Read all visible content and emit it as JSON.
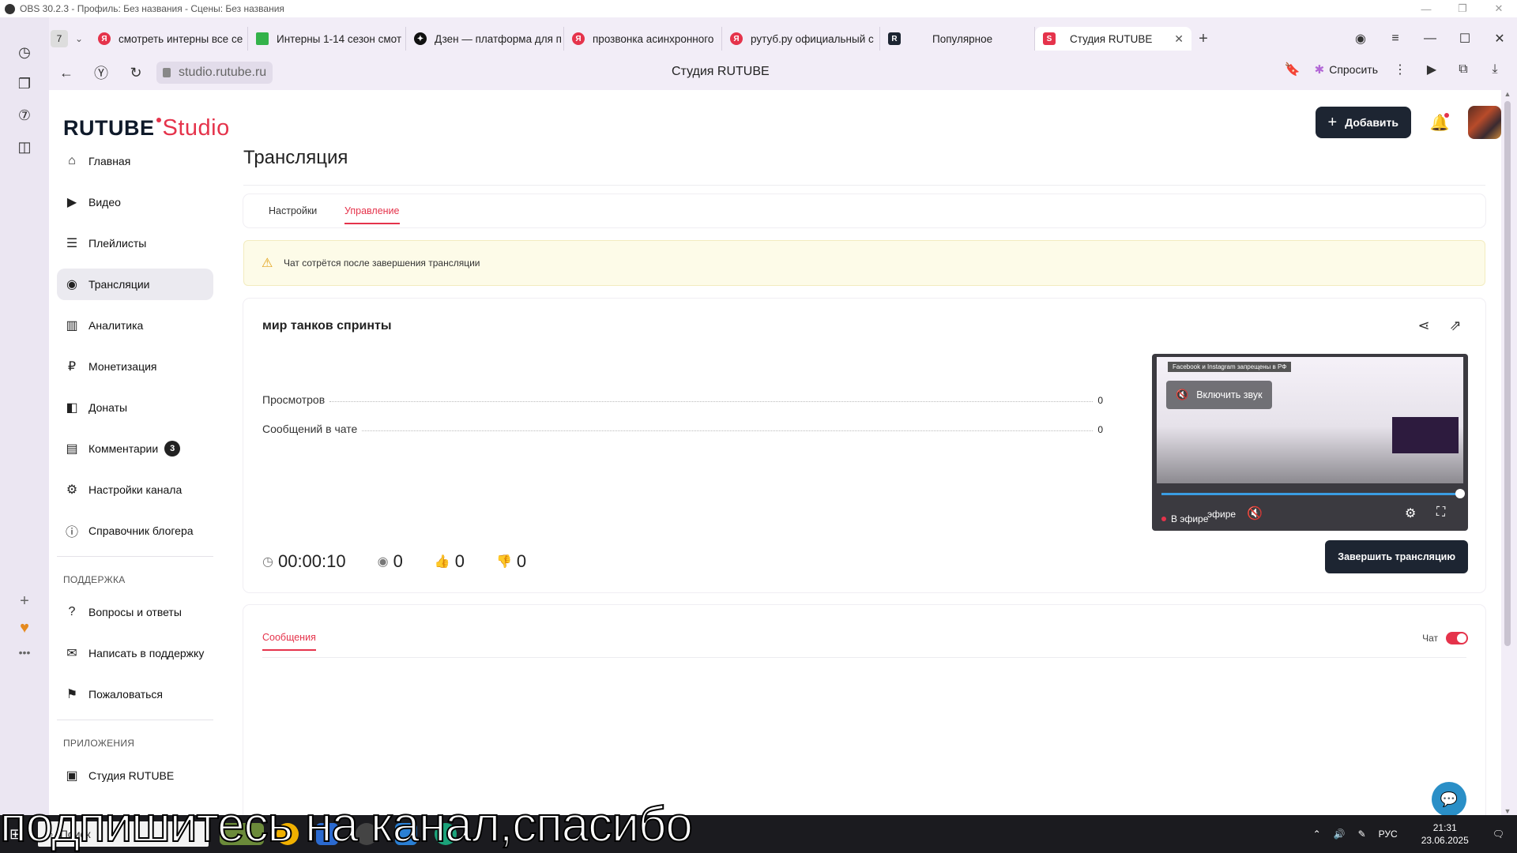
{
  "obs": {
    "title": "OBS 30.2.3 - Профиль: Без названия - Сцены: Без названия"
  },
  "browser": {
    "tab_counter": "7",
    "tabs": [
      {
        "label": "смотреть интерны все се",
        "icon": "yandex-icon",
        "color": "#e5334b"
      },
      {
        "label": "Интерны 1-14 сезон смот",
        "icon": "green-media-icon",
        "color": "#34b24a"
      },
      {
        "label": "Дзен — платформа для п",
        "icon": "dzen-icon",
        "color": "#111111"
      },
      {
        "label": "прозвонка асинхронного",
        "icon": "yandex-icon",
        "color": "#e5334b"
      },
      {
        "label": "рутуб.ру официальный с",
        "icon": "yandex-icon",
        "color": "#e5334b"
      },
      {
        "label": "Популярное",
        "icon": "rutube-icon",
        "color": "#1d2532"
      },
      {
        "label": "Студия RUTUBE",
        "icon": "rutube-studio-icon",
        "color": "#e5334b",
        "active": true
      }
    ],
    "url": "studio.rutube.ru",
    "page_title": "Студия RUTUBE",
    "ask_label": "Спросить"
  },
  "app": {
    "logo_main": "RUTUBE",
    "logo_studio": "Studio",
    "add_button": "Добавить",
    "nav": [
      {
        "label": "Главная",
        "icon": "home-icon"
      },
      {
        "label": "Видео",
        "icon": "video-icon"
      },
      {
        "label": "Плейлисты",
        "icon": "playlist-icon"
      },
      {
        "label": "Трансляции",
        "icon": "broadcast-icon",
        "active": true
      },
      {
        "label": "Аналитика",
        "icon": "analytics-icon"
      },
      {
        "label": "Монетизация",
        "icon": "ruble-icon"
      },
      {
        "label": "Донаты",
        "icon": "donate-icon"
      },
      {
        "label": "Комментарии",
        "icon": "comment-icon",
        "badge": "3"
      },
      {
        "label": "Настройки канала",
        "icon": "gear-icon"
      },
      {
        "label": "Справочник блогера",
        "icon": "info-icon"
      }
    ],
    "support_heading": "ПОДДЕРЖКА",
    "support": [
      {
        "label": "Вопросы и ответы",
        "icon": "question-icon"
      },
      {
        "label": "Написать в поддержку",
        "icon": "mail-icon"
      },
      {
        "label": "Пожаловаться",
        "icon": "flag-icon"
      }
    ],
    "apps_heading": "ПРИЛОЖЕНИЯ",
    "apps": [
      {
        "label": "Студия RUTUBE",
        "icon": "studio-app-icon"
      }
    ]
  },
  "main": {
    "title": "Трансляция",
    "tabs": [
      "Настройки",
      "Управление"
    ],
    "active_tab": "Управление",
    "alert": "Чат сотрётся после завершения трансляции",
    "stream_title": "мир танков спринты",
    "stats": [
      {
        "label": "Просмотров",
        "value": "0"
      },
      {
        "label": "Сообщений в чате",
        "value": "0"
      }
    ],
    "timer": "00:00:10",
    "viewers": "0",
    "likes": "0",
    "dislikes": "0",
    "end_button": "Завершить трансляцию",
    "player": {
      "unmute": "Включить звук",
      "live": "В эфире",
      "live_cut": "эфире",
      "fb_note": "Facebook и Instagram запрещены в РФ",
      "progress": 1.0
    },
    "chat_tab": "Сообщения",
    "chat_toggle_label": "Чат",
    "chat_enabled": true
  },
  "taskbar": {
    "search": "Поиск",
    "lang": "РУС",
    "time": "21:31",
    "date": "23.06.2025"
  },
  "overlay": {
    "caption": "подпишитесь на канал,спасибо"
  }
}
